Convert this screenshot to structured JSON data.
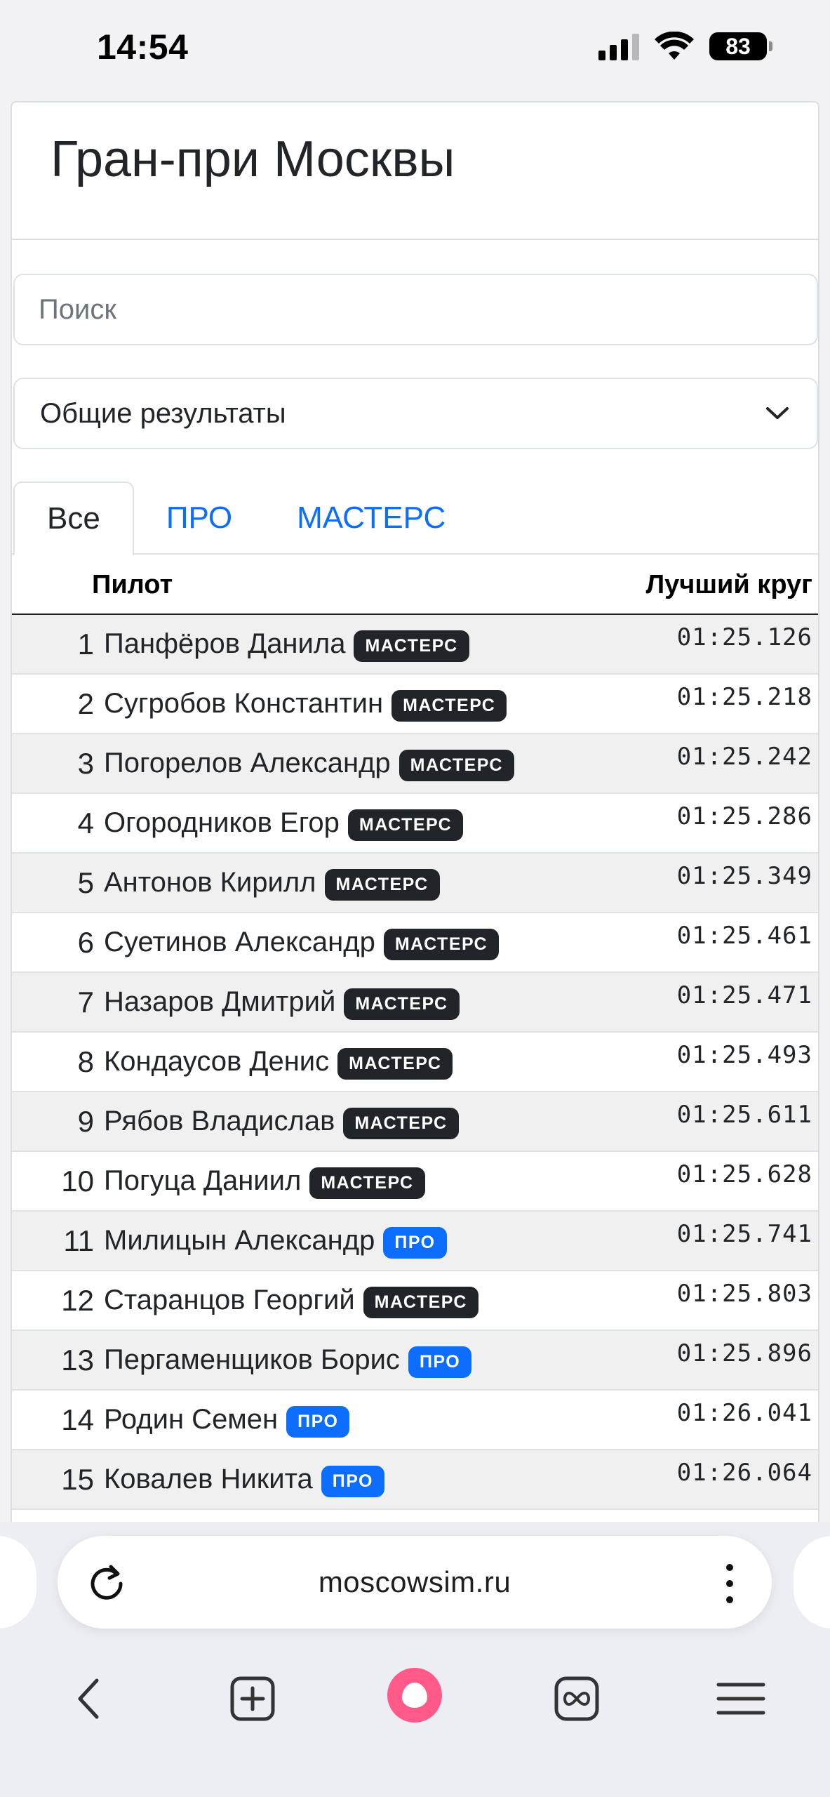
{
  "status": {
    "time": "14:54",
    "battery": "83"
  },
  "page": {
    "title": "Гран-при Москвы",
    "search_placeholder": "Поиск",
    "select_value": "Общие результаты"
  },
  "tabs": [
    {
      "label": "Все",
      "active": true
    },
    {
      "label": "ПРО",
      "active": false
    },
    {
      "label": "МАСТЕРС",
      "active": false
    }
  ],
  "table": {
    "headers": {
      "pilot": "Пилот",
      "best_lap": "Лучший круг"
    },
    "rows": [
      {
        "pos": "1",
        "name": "Панфёров Данила",
        "class": "МАСТЕРС",
        "class_type": "masters",
        "lap": "01:25.126"
      },
      {
        "pos": "2",
        "name": "Сугробов Константин",
        "class": "МАСТЕРС",
        "class_type": "masters",
        "lap": "01:25.218"
      },
      {
        "pos": "3",
        "name": "Погорелов Александр",
        "class": "МАСТЕРС",
        "class_type": "masters",
        "lap": "01:25.242"
      },
      {
        "pos": "4",
        "name": "Огородников Егор",
        "class": "МАСТЕРС",
        "class_type": "masters",
        "lap": "01:25.286"
      },
      {
        "pos": "5",
        "name": "Антонов Кирилл",
        "class": "МАСТЕРС",
        "class_type": "masters",
        "lap": "01:25.349"
      },
      {
        "pos": "6",
        "name": "Суетинов Александр",
        "class": "МАСТЕРС",
        "class_type": "masters",
        "lap": "01:25.461"
      },
      {
        "pos": "7",
        "name": "Назаров Дмитрий",
        "class": "МАСТЕРС",
        "class_type": "masters",
        "lap": "01:25.471"
      },
      {
        "pos": "8",
        "name": "Кондаусов Денис",
        "class": "МАСТЕРС",
        "class_type": "masters",
        "lap": "01:25.493"
      },
      {
        "pos": "9",
        "name": "Рябов Владислав",
        "class": "МАСТЕРС",
        "class_type": "masters",
        "lap": "01:25.611"
      },
      {
        "pos": "10",
        "name": "Погуца Даниил",
        "class": "МАСТЕРС",
        "class_type": "masters",
        "lap": "01:25.628"
      },
      {
        "pos": "11",
        "name": "Милицын Александр",
        "class": "ПРО",
        "class_type": "pro",
        "lap": "01:25.741"
      },
      {
        "pos": "12",
        "name": "Старанцов Георгий",
        "class": "МАСТЕРС",
        "class_type": "masters",
        "lap": "01:25.803"
      },
      {
        "pos": "13",
        "name": "Пергаменщиков Борис",
        "class": "ПРО",
        "class_type": "pro",
        "lap": "01:25.896"
      },
      {
        "pos": "14",
        "name": "Родин Семен",
        "class": "ПРО",
        "class_type": "pro",
        "lap": "01:26.041"
      },
      {
        "pos": "15",
        "name": "Ковалев Никита",
        "class": "ПРО",
        "class_type": "pro",
        "lap": "01:26.064"
      }
    ]
  },
  "browser": {
    "url": "moscowsim.ru"
  },
  "icons": [
    "signal-icon",
    "wifi-icon",
    "battery-icon",
    "chevron-down-icon",
    "reload-icon",
    "more-icon",
    "back-icon",
    "new-tab-icon",
    "alice-icon",
    "tabs-icon",
    "menu-icon"
  ],
  "colors": {
    "link": "#0d6efd",
    "badge_masters": "#212529",
    "badge_pro": "#0d6efd",
    "alice": "#ff5a8a"
  }
}
